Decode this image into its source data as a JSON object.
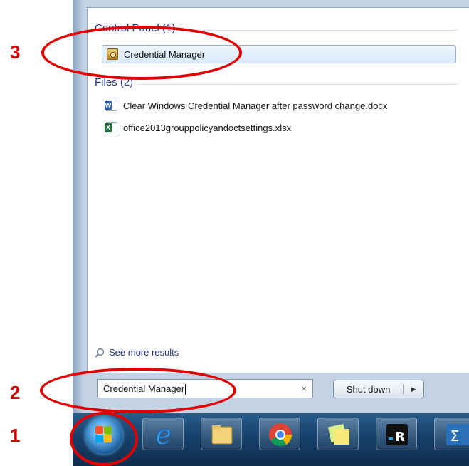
{
  "annotations": {
    "step_1": "1",
    "step_2": "2",
    "step_3": "3",
    "ring_color": "#e00000"
  },
  "results": {
    "control_panel_header": "Control Panel (1)",
    "control_panel_items": [
      {
        "label": "Credential Manager",
        "icon": "credential-manager-icon",
        "selected": true
      }
    ],
    "files_header": "Files (2)",
    "file_items": [
      {
        "label": "Clear Windows Credential Manager after password change.docx",
        "icon": "word-doc-icon"
      },
      {
        "label": "office2013grouppolicyandoctsettings.xlsx",
        "icon": "excel-sheet-icon"
      }
    ],
    "see_more": "See more results"
  },
  "search": {
    "value": "Credential Manager",
    "clear_glyph": "×"
  },
  "shutdown": {
    "label": "Shut down",
    "arrow": "▶"
  },
  "taskbar": {
    "pinned": [
      "start-orb",
      "internet-explorer-icon",
      "file-explorer-icon",
      "chrome-icon",
      "sticky-notes-icon",
      "remote-app-icon",
      "powershell-icon"
    ]
  },
  "colors": {
    "accent": "#1e3287",
    "selection_border": "#8cb2e4",
    "taskbar": "#18436d"
  }
}
